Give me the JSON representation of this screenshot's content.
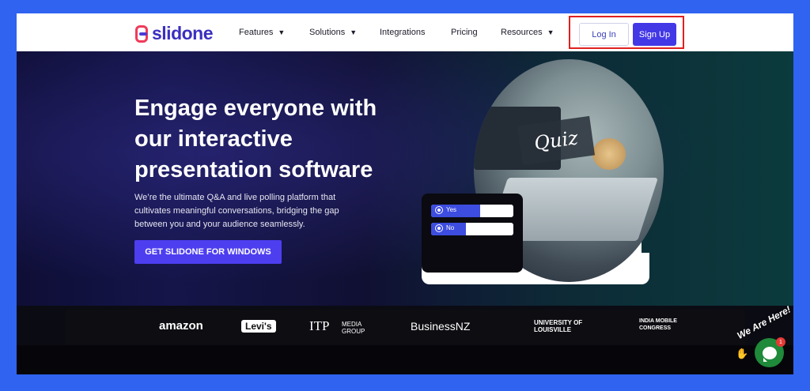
{
  "brand": {
    "name": "slidone"
  },
  "nav": {
    "items": [
      {
        "label": "Features",
        "has_dropdown": true
      },
      {
        "label": "Solutions",
        "has_dropdown": true
      },
      {
        "label": "Integrations",
        "has_dropdown": false
      },
      {
        "label": "Pricing",
        "has_dropdown": false
      },
      {
        "label": "Resources",
        "has_dropdown": true
      }
    ],
    "login_label": "Log In",
    "signup_label": "Sign Up",
    "caret_glyph": "▼"
  },
  "hero": {
    "headline": "Engage everyone with our interactive presentation software",
    "subtext": "We’re the ultimate Q&A and live polling platform that cultivates meaningful conversations, bridging the gap between you and your audience seamlessly.",
    "cta_label": "GET SLIDONE FOR WINDOWS",
    "image_card_text": "Quiz",
    "poll": {
      "options": [
        {
          "label": "Yes",
          "fill_percent": 60
        },
        {
          "label": "No",
          "fill_percent": 42
        }
      ]
    }
  },
  "logos": [
    {
      "name": "amazon"
    },
    {
      "name": "Levi's"
    },
    {
      "name": "ITP",
      "suffix": "MEDIA GROUP"
    },
    {
      "name": "BusinessNZ"
    },
    {
      "name": "UNIVERSITY OF LOUISVILLE"
    },
    {
      "name": "INDIA MOBILE CONGRESS"
    }
  ],
  "chat": {
    "greeting": "We Are Here!",
    "badge_count": "1"
  },
  "colors": {
    "page_border": "#2f63f0",
    "accent": "#4338e6",
    "highlight_box": "#e02020"
  }
}
